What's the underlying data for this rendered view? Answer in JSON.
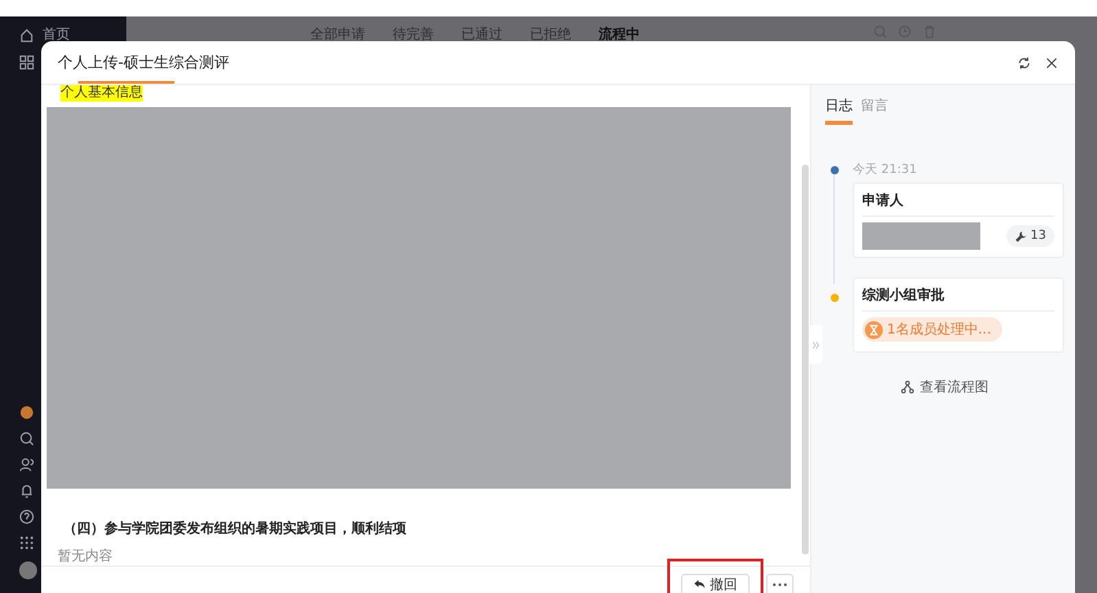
{
  "sidebar": {
    "home": "首页"
  },
  "top_tabs": [
    {
      "label": "全部申请",
      "selected": false
    },
    {
      "label": "待完善",
      "selected": false
    },
    {
      "label": "已通过",
      "selected": false
    },
    {
      "label": "已拒绝",
      "selected": false
    },
    {
      "label": "流程中",
      "selected": true
    }
  ],
  "dialog": {
    "title": "个人上传-硕士生综合测评",
    "section_label": "个人基本信息",
    "item_heading": "（四）参与学院团委发布组织的暑期实践项目，顺利结项",
    "item_value": "暂无内容",
    "buttons": [
      {
        "label": "撤回",
        "kind": "withdraw",
        "highlighted": true
      },
      {
        "kind": "more",
        "highlighted": false
      }
    ]
  },
  "panel_tabs": [
    {
      "label": "日志",
      "selected": true
    },
    {
      "label": "留言",
      "selected": false
    }
  ],
  "timeline": [
    {
      "kind": "applicant",
      "time": "今天 21:31",
      "title": "申请人",
      "color": "#3d6fb6",
      "count": "13"
    },
    {
      "kind": "approval",
      "title": "综测小组审批",
      "color": "#f5b400",
      "status": "1名成员处理中..."
    }
  ],
  "flow_link": "查看流程图"
}
